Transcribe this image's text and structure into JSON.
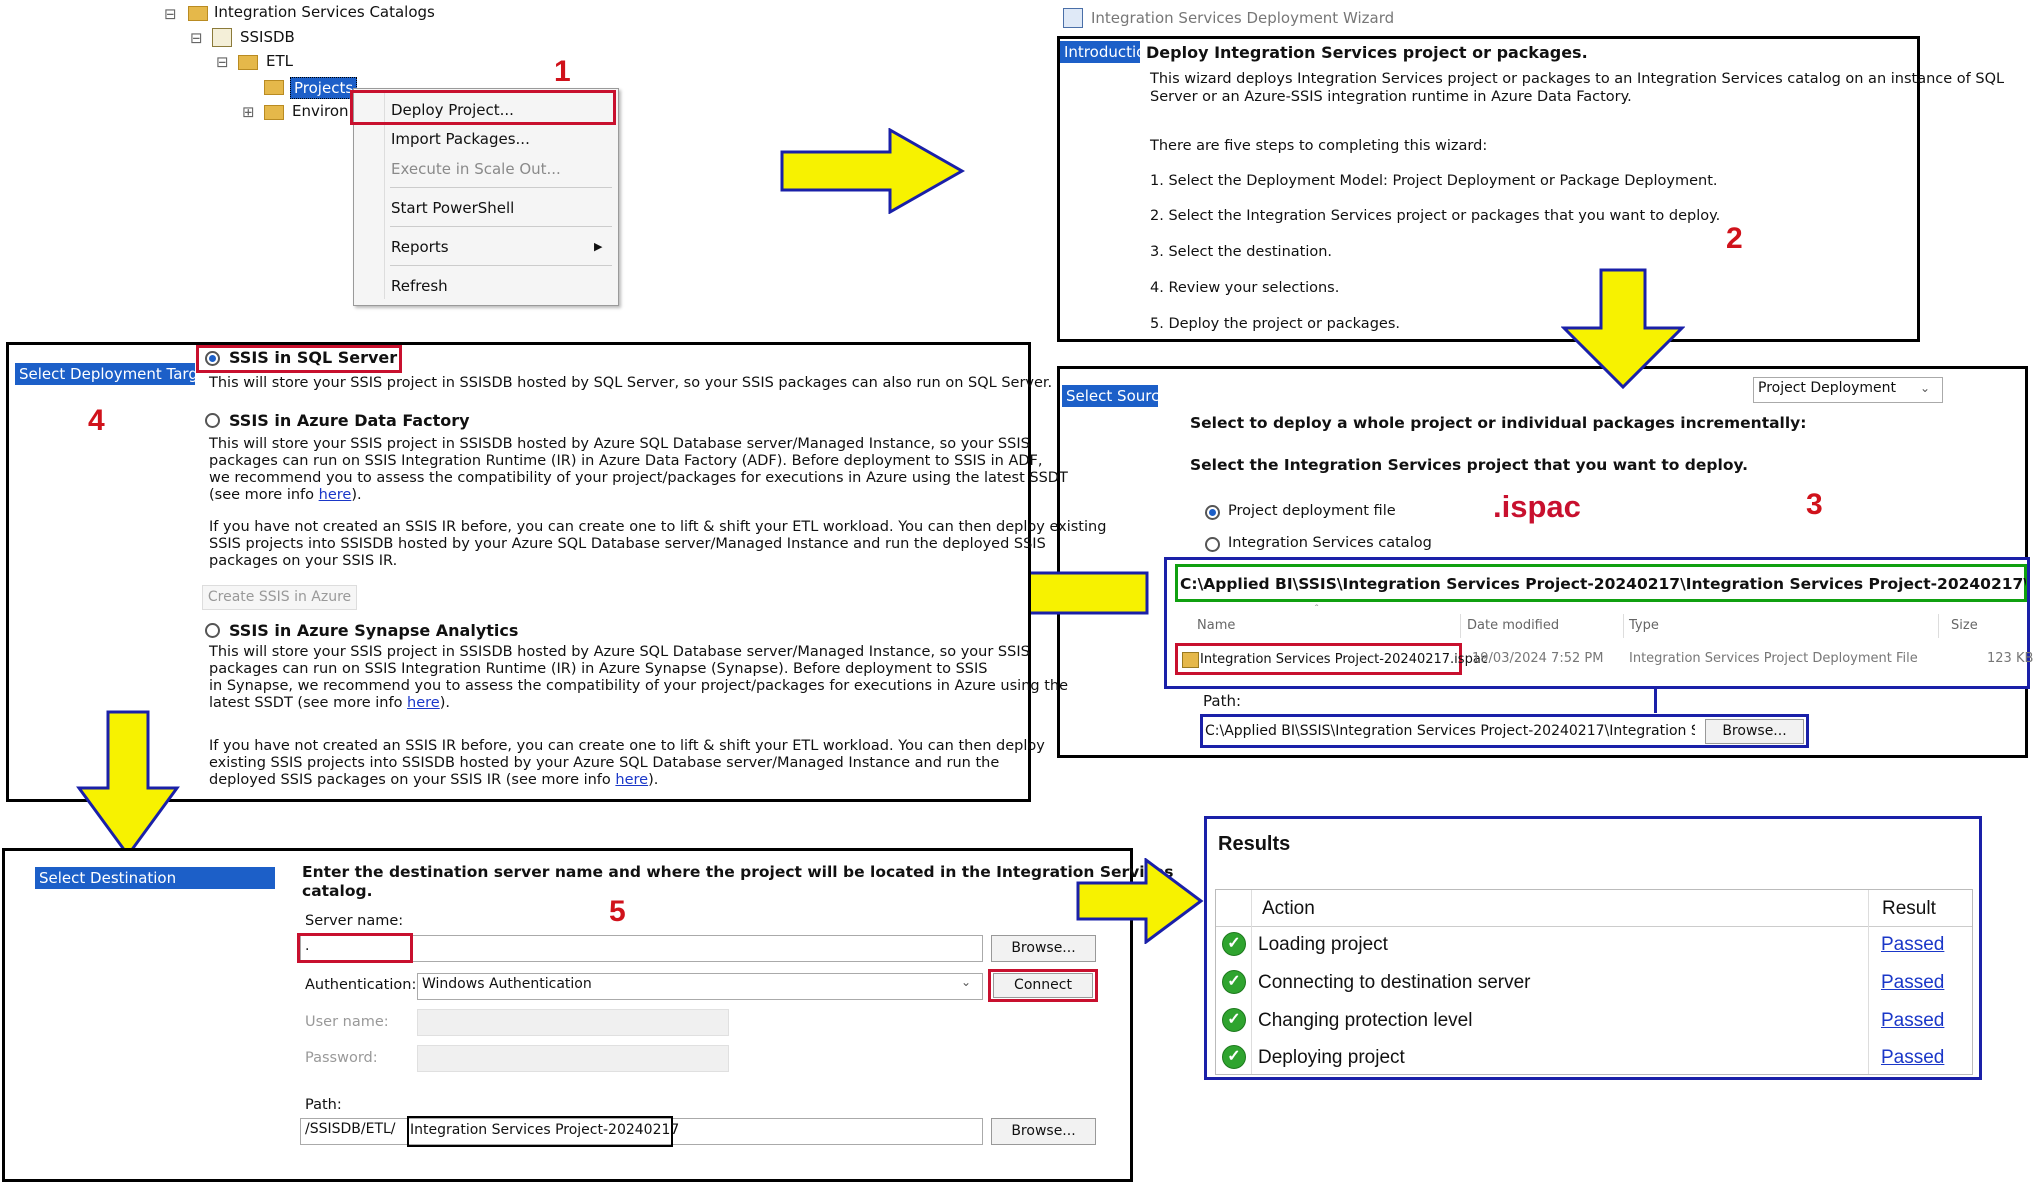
{
  "step_numbers": [
    "1",
    "2",
    "3",
    "4",
    "5"
  ],
  "tree": {
    "catalogs": "Integration Services Catalogs",
    "ssisdb": "SSISDB",
    "etl": "ETL",
    "projects": "Projects",
    "environments": "Environ",
    "expand_minus": "⊟",
    "expand_plus": "⊞"
  },
  "context_menu": {
    "items": [
      "Deploy Project...",
      "Import Packages...",
      "Execute in Scale Out...",
      "Start PowerShell",
      "Reports",
      "Refresh"
    ]
  },
  "wizard": {
    "title": "Integration Services Deployment Wizard",
    "tab": "Introduction",
    "heading": "Deploy Integration Services project or packages.",
    "desc_line1": "This wizard deploys Integration Services project or packages to an Integration Services catalog on an instance of SQL",
    "desc_line2": "Server or an Azure-SSIS integration runtime in Azure Data Factory.",
    "steps_intro": "There are five steps to completing this wizard:",
    "steps": [
      "1. Select the Deployment Model: Project Deployment or Package Deployment.",
      "2. Select the Integration Services project or packages that you want to deploy.",
      "3. Select the destination.",
      "4. Review your selections.",
      "5. Deploy the project or packages."
    ]
  },
  "select_source": {
    "tab": "Select Source",
    "dropdown": "Project Deployment",
    "line1": "Select to deploy a whole project or individual packages incrementally:",
    "line2": "Select the Integration Services project that you want to deploy.",
    "radio1": "Project deployment file",
    "radio2": "Integration Services catalog",
    "ispac_note": ".ispac",
    "folder_path": "C:\\Applied BI\\SSIS\\Integration Services Project-20240217\\Integration Services Project-20240217\\bin\\Development",
    "columns": [
      "Name",
      "Date modified",
      "Type",
      "Size"
    ],
    "file": {
      "name": "Integration Services Project-20240217.ispac",
      "date": "19/03/2024 7:52 PM",
      "type": "Integration Services Project Deployment File",
      "size": "123 KB"
    },
    "path_label": "Path:",
    "path_value": "C:\\Applied BI\\SSIS\\Integration Services Project-20240217\\Integration Ser",
    "browse": "Browse..."
  },
  "deploy_target": {
    "tab": "Select Deployment Target",
    "opt1_title": "SSIS in SQL Server",
    "opt1_desc": "This will store your SSIS project in SSISDB hosted by SQL Server, so your SSIS packages can also run on SQL Server.",
    "opt2_title": "SSIS in Azure Data Factory",
    "opt2_lines": [
      "This will store your SSIS project in SSISDB hosted by Azure SQL Database server/Managed Instance, so your SSIS",
      "packages can run on SSIS Integration Runtime (IR) in Azure Data Factory (ADF). Before deployment to SSIS in ADF,",
      "we recommend you to assess the compatibility of your project/packages for executions in Azure using the latest SSDT",
      "(see more info "
    ],
    "opt2_note_lines": [
      "If you have not created an SSIS IR before, you can create one to lift & shift your ETL workload. You can then deploy existing",
      "SSIS projects into SSISDB hosted by your Azure SQL Database server/Managed Instance and run the deployed SSIS",
      "packages on your SSIS IR."
    ],
    "create_button": "Create SSIS in Azure",
    "opt3_title": "SSIS in Azure Synapse Analytics",
    "opt3_lines": [
      "This will store your SSIS project in SSISDB hosted by Azure SQL Database server/Managed Instance, so your SSIS",
      "packages can run on SSIS Integration Runtime (IR) in Azure Synapse (Synapse). Before deployment to SSIS",
      "in Synapse, we recommend you to assess the compatibility of your project/packages for executions in Azure using the",
      "latest SSDT (see more info "
    ],
    "opt3_note_lines": [
      "If you have not created an SSIS IR before, you can create one to lift & shift your ETL workload. You can then deploy",
      "existing SSIS projects into SSISDB hosted by your Azure SQL Database server/Managed Instance and run the",
      "deployed SSIS packages on your SSIS IR (see more info "
    ],
    "here": "here",
    "close_paren": ").",
    "close_paren_only": ")"
  },
  "destination": {
    "tab": "Select Destination",
    "heading_line1": "Enter the destination server name and where the project will be located in the Integration Services",
    "heading_line2": "catalog.",
    "server_label": "Server name:",
    "server_value": ".",
    "browse": "Browse...",
    "auth_label": "Authentication:",
    "auth_value": "Windows Authentication",
    "connect": "Connect",
    "user_label": "User name:",
    "password_label": "Password:",
    "path_label": "Path:",
    "path_prefix": "/SSISDB/ETL/",
    "path_project": "Integration Services Project-20240217"
  },
  "results": {
    "title": "Results",
    "col_action": "Action",
    "col_result": "Result",
    "rows": [
      {
        "action": "Loading project",
        "result": "Passed"
      },
      {
        "action": "Connecting to destination server",
        "result": "Passed"
      },
      {
        "action": "Changing protection level",
        "result": "Passed"
      },
      {
        "action": "Deploying project",
        "result": "Passed"
      }
    ]
  },
  "colors": {
    "arrow": "#f7f200",
    "red": "#c8102e",
    "blue": "#1a20a8",
    "green": "#10a010",
    "tab_blue": "#1c5fc8"
  }
}
